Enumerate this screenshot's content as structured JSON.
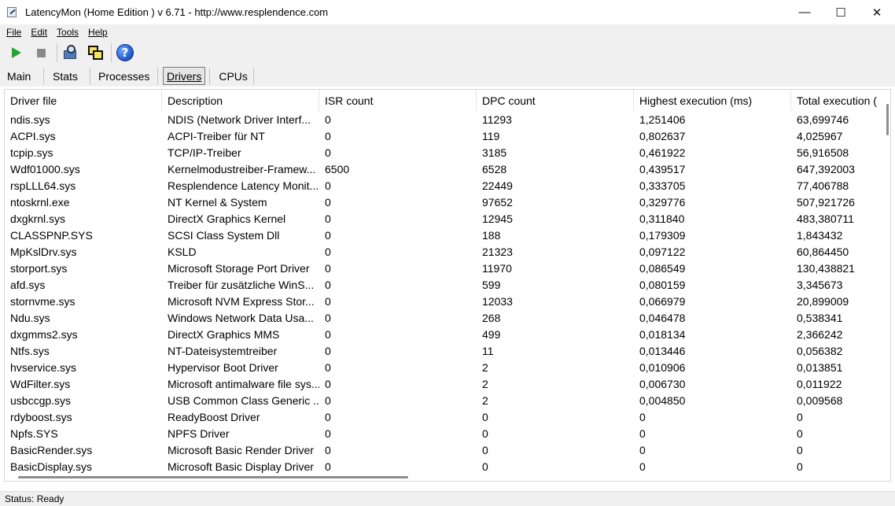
{
  "window": {
    "title": "LatencyMon  (Home Edition )  v 6.71 - http://www.resplendence.com",
    "minimize_glyph": "—",
    "maximize_glyph": "☐",
    "close_glyph": "✕"
  },
  "menu": {
    "file": "File",
    "edit": "Edit",
    "tools": "Tools",
    "help": "Help"
  },
  "toolbar": {
    "start_icon": "play-icon",
    "stop_icon": "stop-icon",
    "inspect_icon": "magnifier-computer-icon",
    "windows_icon": "windows-icon",
    "help_icon": "help-icon",
    "help_glyph": "?"
  },
  "tabs": {
    "main": "Main",
    "stats": "Stats",
    "processes": "Processes",
    "drivers": "Drivers",
    "cpus": "CPUs"
  },
  "table": {
    "columns": [
      "Driver file",
      "Description",
      "ISR count",
      "DPC count",
      "Highest execution (ms)",
      "Total execution ("
    ],
    "rows": [
      [
        "ndis.sys",
        "NDIS (Network Driver Interf...",
        "0",
        "11293",
        "1,251406",
        "63,699746"
      ],
      [
        "ACPI.sys",
        "ACPI-Treiber für NT",
        "0",
        "119",
        "0,802637",
        "4,025967"
      ],
      [
        "tcpip.sys",
        "TCP/IP-Treiber",
        "0",
        "3185",
        "0,461922",
        "56,916508"
      ],
      [
        "Wdf01000.sys",
        "Kernelmodustreiber-Framew...",
        "6500",
        "6528",
        "0,439517",
        "647,392003"
      ],
      [
        "rspLLL64.sys",
        "Resplendence Latency Monit...",
        "0",
        "22449",
        "0,333705",
        "77,406788"
      ],
      [
        "ntoskrnl.exe",
        "NT Kernel & System",
        "0",
        "97652",
        "0,329776",
        "507,921726"
      ],
      [
        "dxgkrnl.sys",
        "DirectX Graphics Kernel",
        "0",
        "12945",
        "0,311840",
        "483,380711"
      ],
      [
        "CLASSPNP.SYS",
        "SCSI Class System Dll",
        "0",
        "188",
        "0,179309",
        "1,843432"
      ],
      [
        "MpKslDrv.sys",
        "KSLD",
        "0",
        "21323",
        "0,097122",
        "60,864450"
      ],
      [
        "storport.sys",
        "Microsoft Storage Port Driver",
        "0",
        "11970",
        "0,086549",
        "130,438821"
      ],
      [
        "afd.sys",
        "Treiber für zusätzliche WinS...",
        "0",
        "599",
        "0,080159",
        "3,345673"
      ],
      [
        "stornvme.sys",
        "Microsoft NVM Express Stor...",
        "0",
        "12033",
        "0,066979",
        "20,899009"
      ],
      [
        "Ndu.sys",
        "Windows Network Data Usa...",
        "0",
        "268",
        "0,046478",
        "0,538341"
      ],
      [
        "dxgmms2.sys",
        "DirectX Graphics MMS",
        "0",
        "499",
        "0,018134",
        "2,366242"
      ],
      [
        "Ntfs.sys",
        "NT-Dateisystemtreiber",
        "0",
        "11",
        "0,013446",
        "0,056382"
      ],
      [
        "hvservice.sys",
        "Hypervisor Boot Driver",
        "0",
        "2",
        "0,010906",
        "0,013851"
      ],
      [
        "WdFilter.sys",
        "Microsoft antimalware file sys...",
        "0",
        "2",
        "0,006730",
        "0,011922"
      ],
      [
        "usbccgp.sys",
        "USB Common Class Generic ...",
        "0",
        "2",
        "0,004850",
        "0,009568"
      ],
      [
        "rdyboost.sys",
        "ReadyBoost Driver",
        "0",
        "0",
        "0",
        "0"
      ],
      [
        "Npfs.SYS",
        "NPFS Driver",
        "0",
        "0",
        "0",
        "0"
      ],
      [
        "BasicRender.sys",
        "Microsoft Basic Render Driver",
        "0",
        "0",
        "0",
        "0"
      ],
      [
        "BasicDisplay.sys",
        "Microsoft Basic Display Driver",
        "0",
        "0",
        "0",
        "0"
      ]
    ]
  },
  "status": {
    "text": "Status: Ready"
  }
}
